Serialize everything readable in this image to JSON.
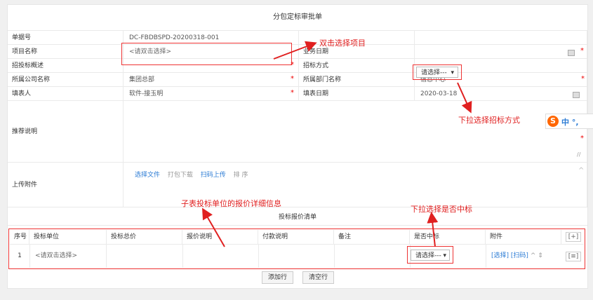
{
  "form": {
    "title": "分包定标审批单",
    "doc_no_label": "单据号",
    "doc_no_value": "DC-FBDBSPD-20200318-001",
    "project_label": "项目名称",
    "project_placeholder": "<请双击选择>",
    "biz_date_label": "业务日期",
    "bid_summary_label": "招投标概述",
    "bid_method_label": "招标方式",
    "bid_method_value": "请选择---",
    "company_label": "所属公司名称",
    "company_value": "集团总部",
    "dept_label": "所属部门名称",
    "dept_value": "信息中心",
    "filler_label": "填表人",
    "filler_value": "软件-接玉明",
    "fill_date_label": "填表日期",
    "fill_date_value": "2020-03-18",
    "recommend_label": "推荐说明",
    "attach_label": "上传附件",
    "attach_actions": [
      "选择文件",
      "打包下载",
      "扫码上传",
      "排 序"
    ]
  },
  "annotations": {
    "a1": "双击选择项目",
    "a2": "下拉选择招标方式",
    "a3": "子表投标单位的报价详细信息",
    "a4": "下拉选择是否中标"
  },
  "ime": {
    "logo": "S",
    "text": "中 °,"
  },
  "subtable": {
    "title": "投标报价清单",
    "columns": [
      "序号",
      "投标单位",
      "投标总价",
      "报价说明",
      "付款说明",
      "备注",
      "是否中标",
      "附件"
    ],
    "add_col": "[+]",
    "row": {
      "index": "1",
      "unit": "<请双击选择>",
      "win_value": "请选择---",
      "attach_select": "[选择]",
      "attach_scan": "[扫码]",
      "menu": "[≡]"
    },
    "add_row": "添加行",
    "clear_rows": "清空行"
  },
  "colors": {
    "annotation": "#e02020",
    "link": "#2b7bd4",
    "required": "#e00000"
  }
}
